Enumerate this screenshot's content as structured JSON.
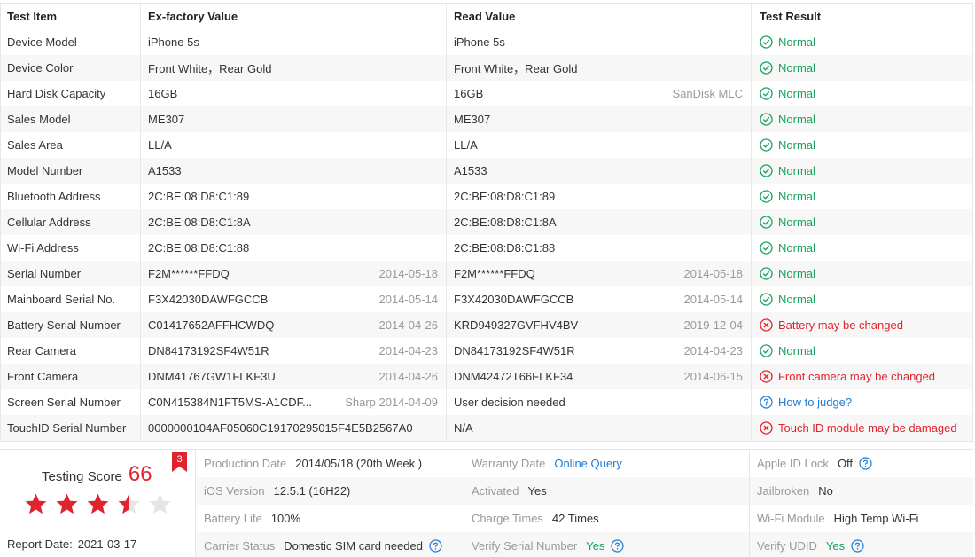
{
  "table": {
    "headers": [
      "Test Item",
      "Ex-factory Value",
      "Read Value",
      "Test Result"
    ],
    "rows": [
      {
        "item": "Device Model",
        "ex": "iPhone 5s",
        "ex_date": "",
        "read": "iPhone 5s",
        "read_date": "",
        "result": "Normal",
        "status": "ok"
      },
      {
        "item": "Device Color",
        "ex": "Front White，Rear Gold",
        "ex_date": "",
        "read": "Front White，Rear Gold",
        "read_date": "",
        "result": "Normal",
        "status": "ok"
      },
      {
        "item": "Hard Disk Capacity",
        "ex": "16GB",
        "ex_date": "",
        "read": "16GB",
        "read_date": "SanDisk MLC",
        "result": "Normal",
        "status": "ok"
      },
      {
        "item": "Sales Model",
        "ex": "ME307",
        "ex_date": "",
        "read": "ME307",
        "read_date": "",
        "result": "Normal",
        "status": "ok"
      },
      {
        "item": "Sales Area",
        "ex": "LL/A",
        "ex_date": "",
        "read": "LL/A",
        "read_date": "",
        "result": "Normal",
        "status": "ok"
      },
      {
        "item": "Model Number",
        "ex": "A1533",
        "ex_date": "",
        "read": "A1533",
        "read_date": "",
        "result": "Normal",
        "status": "ok"
      },
      {
        "item": "Bluetooth Address",
        "ex": "2C:BE:08:D8:C1:89",
        "ex_date": "",
        "read": "2C:BE:08:D8:C1:89",
        "read_date": "",
        "result": "Normal",
        "status": "ok"
      },
      {
        "item": "Cellular Address",
        "ex": "2C:BE:08:D8:C1:8A",
        "ex_date": "",
        "read": "2C:BE:08:D8:C1:8A",
        "read_date": "",
        "result": "Normal",
        "status": "ok"
      },
      {
        "item": "Wi-Fi Address",
        "ex": "2C:BE:08:D8:C1:88",
        "ex_date": "",
        "read": "2C:BE:08:D8:C1:88",
        "read_date": "",
        "result": "Normal",
        "status": "ok"
      },
      {
        "item": "Serial Number",
        "ex": "F2M******FFDQ",
        "ex_date": "2014-05-18",
        "read": "F2M******FFDQ",
        "read_date": "2014-05-18",
        "result": "Normal",
        "status": "ok"
      },
      {
        "item": "Mainboard Serial No.",
        "ex": "F3X42030DAWFGCCB",
        "ex_date": "2014-05-14",
        "read": "F3X42030DAWFGCCB",
        "read_date": "2014-05-14",
        "result": "Normal",
        "status": "ok"
      },
      {
        "item": "Battery Serial Number",
        "ex": "C01417652AFFHCWDQ",
        "ex_date": "2014-04-26",
        "read": "KRD949327GVFHV4BV",
        "read_date": "2019-12-04",
        "result": "Battery may be changed",
        "status": "bad"
      },
      {
        "item": "Rear Camera",
        "ex": "DN84173192SF4W51R",
        "ex_date": "2014-04-23",
        "read": "DN84173192SF4W51R",
        "read_date": "2014-04-23",
        "result": "Normal",
        "status": "ok"
      },
      {
        "item": "Front Camera",
        "ex": "DNM41767GW1FLKF3U",
        "ex_date": "2014-04-26",
        "read": "DNM42472T66FLKF34",
        "read_date": "2014-06-15",
        "result": "Front camera may be changed",
        "status": "bad"
      },
      {
        "item": "Screen Serial Number",
        "ex": "C0N415384N1FT5MS-A1CDF...",
        "ex_date": "Sharp 2014-04-09",
        "read": "User decision needed",
        "read_date": "",
        "result": "How to judge?",
        "status": "info"
      },
      {
        "item": "TouchID Serial Number",
        "ex": "0000000104AF05060C19170295015F4E5B2567A0",
        "ex_date": "",
        "read": "N/A",
        "read_date": "",
        "result": "Touch ID module may be damaged",
        "status": "bad"
      }
    ]
  },
  "score": {
    "label": "Testing Score",
    "value": "66",
    "badge": "3",
    "stars": 3.5,
    "stars_max": 5,
    "report_label": "Report Date:",
    "report_date": "2021-03-17"
  },
  "info": {
    "production_date_label": "Production Date",
    "production_date": "2014/05/18 (20th Week )",
    "warranty_label": "Warranty Date",
    "warranty": "Online Query",
    "apple_id_label": "Apple ID Lock",
    "apple_id": "Off",
    "ios_label": "iOS Version",
    "ios": "12.5.1 (16H22)",
    "activated_label": "Activated",
    "activated": "Yes",
    "jailbroken_label": "Jailbroken",
    "jailbroken": "No",
    "battery_label": "Battery Life",
    "battery": "100%",
    "charge_label": "Charge Times",
    "charge": "42 Times",
    "wifi_label": "Wi-Fi Module",
    "wifi": "High Temp Wi-Fi",
    "carrier_label": "Carrier Status",
    "carrier": "Domestic SIM card needed",
    "verify_serial_label": "Verify Serial Number",
    "verify_serial": "Yes",
    "verify_udid_label": "Verify UDID",
    "verify_udid": "Yes"
  },
  "colors": {
    "ok": "#1aa15f",
    "bad": "#e0242e",
    "info": "#1e7bd6",
    "star": "#e0242e",
    "star_empty": "#e5e5e5"
  }
}
